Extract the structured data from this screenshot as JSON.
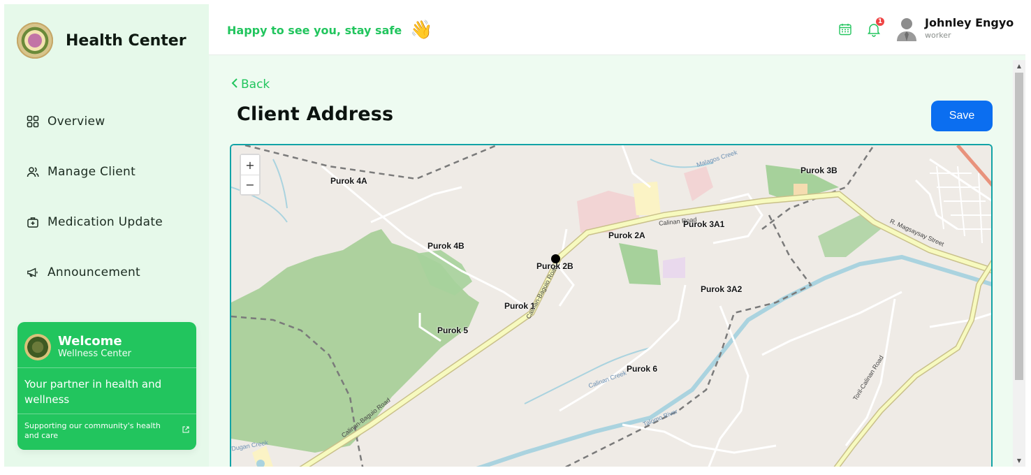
{
  "brand": {
    "title": "Health Center"
  },
  "sidebar": {
    "items": [
      {
        "label": "Overview",
        "icon": "grid-icon"
      },
      {
        "label": "Manage Client",
        "icon": "users-icon"
      },
      {
        "label": "Medication Update",
        "icon": "medical-kit-icon"
      },
      {
        "label": "Announcement",
        "icon": "megaphone-icon"
      }
    ],
    "welcome": {
      "title": "Welcome",
      "subtitle": "Wellness Center",
      "text": "Your partner in health and wellness",
      "footer": "Supporting our community's health and care"
    }
  },
  "header": {
    "greeting": "Happy to see you, stay safe",
    "wave": "👋",
    "notification_count": "1",
    "user_name": "Johnley Engyo",
    "user_role": "worker"
  },
  "main": {
    "back_label": "Back",
    "title": "Client Address",
    "save_label": "Save"
  },
  "map": {
    "zoom_in": "+",
    "zoom_out": "−",
    "places": [
      "Purok 4A",
      "Purok 4B",
      "Purok 2B",
      "Purok 2A",
      "Purok 3A1",
      "Purok 3B",
      "Purok 3A2",
      "Purok 1",
      "Purok 5",
      "Purok 6"
    ],
    "roads": [
      "Calinan-Baguio Road",
      "Calinan Road",
      "R. Magsaysay Street",
      "Toril-Calinan Road",
      "Calinan Creek",
      "Talomo River",
      "Malagos Creek",
      "Dugan Creek"
    ]
  },
  "colors": {
    "accent_green": "#22c55e",
    "save_blue": "#0b6ef0",
    "sidebar_bg": "#e6f9ea",
    "map_border": "#12a3a6"
  }
}
